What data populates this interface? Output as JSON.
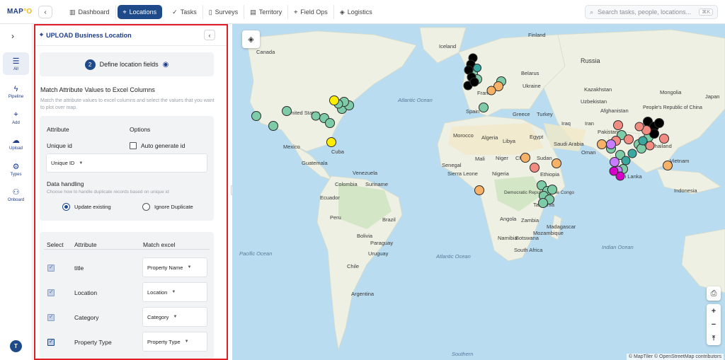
{
  "app": {
    "logo_main": "MAP",
    "logo_accent": "°O"
  },
  "nav": [
    {
      "label": "Dashboard",
      "icon": "chart-icon"
    },
    {
      "label": "Locations",
      "icon": "pin-icon",
      "active": true
    },
    {
      "label": "Tasks",
      "icon": "tasks-icon"
    },
    {
      "label": "Surveys",
      "icon": "clipboard-icon"
    },
    {
      "label": "Territory",
      "icon": "map-icon"
    },
    {
      "label": "Field Ops",
      "icon": "pin-icon"
    },
    {
      "label": "Logistics",
      "icon": "box-icon"
    }
  ],
  "search": {
    "placeholder": "Search tasks, people, locations...",
    "shortcut": "⌘K"
  },
  "rail": [
    {
      "label": "All",
      "icon": "list-icon",
      "active": true
    },
    {
      "label": "Pipeline",
      "icon": "bolt-icon"
    },
    {
      "label": "Add",
      "icon": "pin-icon"
    },
    {
      "label": "Upload",
      "icon": "cloud-upload-icon"
    },
    {
      "label": "Types",
      "icon": "gear-icon"
    },
    {
      "label": "Onboard",
      "icon": "users-icon"
    }
  ],
  "user": {
    "initial": "T"
  },
  "panel": {
    "title": "UPLOAD Business Location",
    "step": {
      "number": "2",
      "label": "Define location fields"
    },
    "section_title": "Match Attribute Values to Excel Columns",
    "section_desc": "Match the attribute values to excel columns and select the values that you want to plot over map.",
    "card1": {
      "col_attribute": "Attribute",
      "col_options": "Options",
      "unique_label": "Unique id",
      "auto_generate": "Auto generate id",
      "auto_generate_checked": false,
      "unique_select": "Unique ID",
      "data_handling": "Data handling",
      "data_handling_desc": "Choose how to handle duplicate records based on unique id",
      "opt_update": "Update existing",
      "opt_ignore": "Ignore Duplicate",
      "selected_option": "Update existing"
    },
    "card2": {
      "col_select": "Select",
      "col_attribute": "Attribute",
      "col_match": "Match excel",
      "rows": [
        {
          "attribute": "title",
          "match": "Property Name",
          "checked": true
        },
        {
          "attribute": "Location",
          "match": "Location",
          "checked": true
        },
        {
          "attribute": "Category",
          "match": "Category",
          "checked": true
        },
        {
          "attribute": "Property Type",
          "match": "Property Type",
          "checked": true
        }
      ]
    }
  },
  "map": {
    "labels": [
      "Canada",
      "United States",
      "Mexico",
      "Cuba",
      "Guatemala",
      "Venezuela",
      "Colombia",
      "Suriname",
      "Ecuador",
      "Peru",
      "Brazil",
      "Bolivia",
      "Paraguay",
      "Chile",
      "Uruguay",
      "Argentina",
      "Atlantic Ocean",
      "Atlantic Ocean",
      "Pacific Ocean",
      "Indian Ocean",
      "Iceland",
      "Finland",
      "Russia",
      "Belarus",
      "Ukraine",
      "Kazakhstan",
      "Mongolia",
      "France",
      "Spain",
      "Turkey",
      "Greece",
      "Morocco",
      "Algeria",
      "Libya",
      "Egypt",
      "Mali",
      "Niger",
      "Chad",
      "Sudan",
      "Senegal",
      "Sierra Leone",
      "Nigeria",
      "Ethiopia",
      "Democratic Republic of the Congo",
      "Tanzania",
      "Angola",
      "Zambia",
      "Namibia",
      "Botswana",
      "South Africa",
      "Madagascar",
      "Mozambique",
      "Saudi Arabia",
      "Iraq",
      "Iran",
      "Afghanistan",
      "Pakistan",
      "Oman",
      "Sri Lanka",
      "Thailand",
      "Vietnam",
      "Indonesia",
      "People's Republic of China",
      "Uzbekistan",
      "Japan",
      "Southern"
    ],
    "attribution": "© MapTiler © OpenStreetMap contributors",
    "colors": {
      "green": "#7ecba8",
      "yellow": "#ffee00",
      "black": "#000000",
      "orange": "#f7b267",
      "salmon": "#f28b82",
      "purple": "#c77dff",
      "magenta": "#d600c8",
      "teal": "#3aa8a0"
    }
  }
}
